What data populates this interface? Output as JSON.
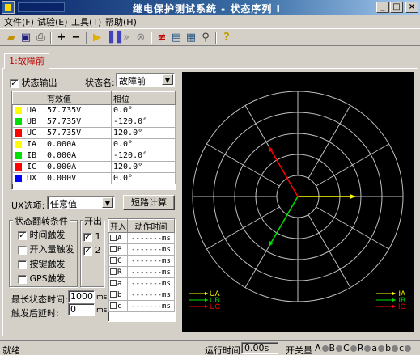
{
  "window": {
    "title": "继电保护测试系统 - 状态序列 I"
  },
  "menu": [
    "文件(F)",
    "试验(E)",
    "工具(T)",
    "帮助(H)"
  ],
  "toolbar": [
    "open-icon",
    "save-icon",
    "print-icon",
    "add-icon",
    "remove-icon",
    "run-icon",
    "pause-icon",
    "forward-icon",
    "stop-icon",
    "measure-icon",
    "report-icon",
    "grid-icon",
    "zoom-icon",
    "help-icon"
  ],
  "tab": {
    "label": "1:故障前"
  },
  "state": {
    "output_label": "状态输出",
    "output_checked": true,
    "name_label": "状态名:",
    "name_value": "故障前"
  },
  "grid": {
    "headers": [
      "",
      "有效值",
      "相位"
    ],
    "rows": [
      {
        "name": "UA",
        "color": "#ffff00",
        "value": "57.735V",
        "phase": "0.0°"
      },
      {
        "name": "UB",
        "color": "#00e000",
        "value": "57.735V",
        "phase": "-120.0°"
      },
      {
        "name": "UC",
        "color": "#ff0000",
        "value": "57.735V",
        "phase": "120.0°"
      },
      {
        "name": "IA",
        "color": "#ffff00",
        "value": "0.000A",
        "phase": "0.0°"
      },
      {
        "name": "IB",
        "color": "#00e000",
        "value": "0.000A",
        "phase": "-120.0°"
      },
      {
        "name": "IC",
        "color": "#ff0000",
        "value": "0.000A",
        "phase": "120.0°"
      },
      {
        "name": "UX",
        "color": "#0000ff",
        "value": "0.000V",
        "phase": "0.0°"
      }
    ]
  },
  "ux": {
    "label": "UX选项:",
    "value": "任意值",
    "calc_button": "短路计算"
  },
  "trigger": {
    "group_label": "状态翻转条件",
    "options": [
      {
        "label": "时间触发",
        "checked": true
      },
      {
        "label": "开入量触发",
        "checked": false
      },
      {
        "label": "按键触发",
        "checked": false
      },
      {
        "label": "GPS触发",
        "checked": false
      }
    ],
    "max_time_label": "最长状态时间:",
    "max_time_value": "1000",
    "max_time_unit": "ms",
    "delay_label": "触发后延时:",
    "delay_value": "0",
    "delay_unit": "ms"
  },
  "binary_out": {
    "label": "开出",
    "items": [
      {
        "label": "1",
        "checked": true
      },
      {
        "label": "2",
        "checked": true
      }
    ]
  },
  "binary_in": {
    "headers": [
      "开入",
      "动作时间"
    ],
    "rows": [
      {
        "name": "A",
        "time": "-------ms"
      },
      {
        "name": "B",
        "time": "-------ms"
      },
      {
        "name": "C",
        "time": "-------ms"
      },
      {
        "name": "R",
        "time": "-------ms"
      },
      {
        "name": "a",
        "time": "-------ms"
      },
      {
        "name": "b",
        "time": "-------ms"
      },
      {
        "name": "c",
        "time": "-------ms"
      }
    ]
  },
  "phasor": {
    "rings": 5,
    "spokes_deg": 30,
    "voltages": [
      {
        "name": "UA",
        "color": "#ffff00",
        "angle": 0,
        "mag": 57.735
      },
      {
        "name": "UB",
        "color": "#00e000",
        "angle": -120,
        "mag": 57.735
      },
      {
        "name": "UC",
        "color": "#ff0000",
        "angle": 120,
        "mag": 57.735
      }
    ],
    "currents": [
      {
        "name": "IA",
        "color": "#ffff00"
      },
      {
        "name": "IB",
        "color": "#00e000"
      },
      {
        "name": "IC",
        "color": "#ff0000"
      }
    ]
  },
  "status": {
    "ready": "就绪",
    "run_time_label": "运行时间",
    "run_time_value": "0.00s",
    "switch_label": "开关量",
    "switches": [
      "A",
      "B",
      "C",
      "R",
      "a",
      "b",
      "c"
    ]
  }
}
